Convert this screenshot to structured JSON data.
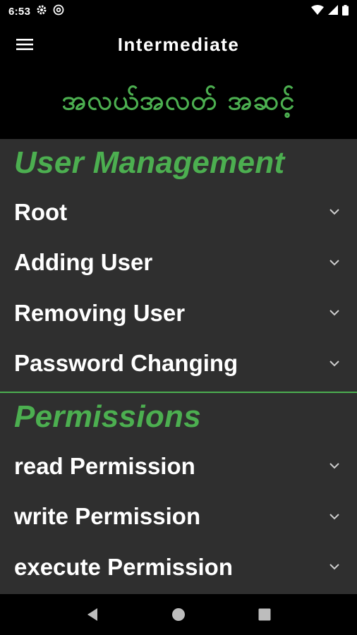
{
  "status_bar": {
    "time": "6:53",
    "icons_left": [
      "gear-icon",
      "at-sign-icon"
    ],
    "icons_right": [
      "wifi-icon",
      "signal-icon",
      "battery-icon"
    ]
  },
  "header": {
    "title": "Intermediate",
    "subtitle": "အလယ်အလတ် အဆင့်"
  },
  "sections": [
    {
      "title": "User Management",
      "items": [
        "Root",
        "Adding User",
        "Removing User",
        "Password Changing"
      ]
    },
    {
      "title": "Permissions",
      "items": [
        "read Permission",
        "write Permission",
        "execute Permission"
      ]
    }
  ],
  "nav_bar": {
    "buttons": [
      "back-icon",
      "home-icon",
      "recents-icon"
    ]
  },
  "colors": {
    "accent": "#4caf50",
    "background": "#2f2f2f",
    "header_bg": "#000000",
    "text": "#ffffff"
  }
}
